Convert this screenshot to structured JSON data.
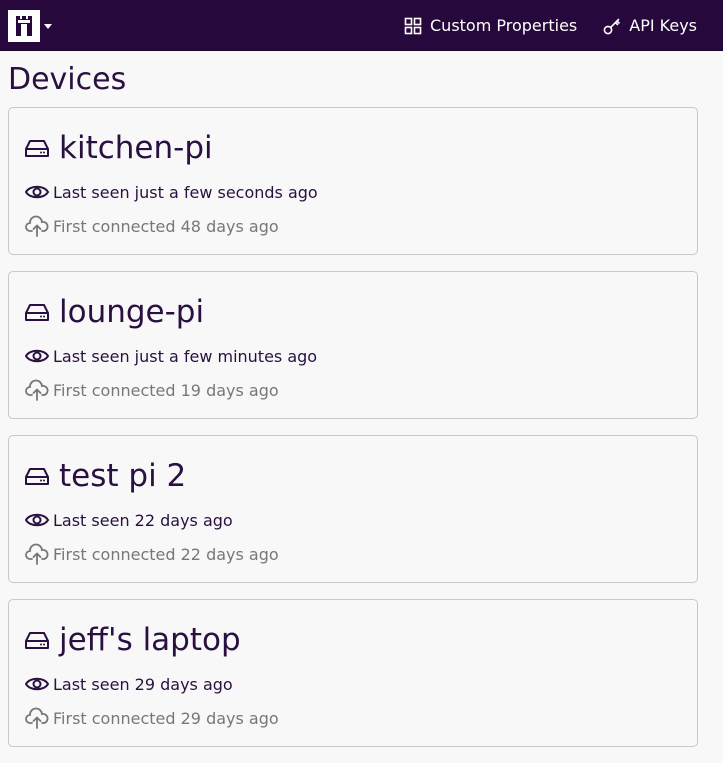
{
  "nav": {
    "custom_properties": "Custom Properties",
    "api_keys": "API Keys"
  },
  "page": {
    "title": "Devices"
  },
  "devices": [
    {
      "name": "kitchen-pi",
      "last_seen": "Last seen just a few seconds ago",
      "first_connected": "First connected 48 days ago"
    },
    {
      "name": "lounge-pi",
      "last_seen": "Last seen just a few minutes ago",
      "first_connected": "First connected 19 days ago"
    },
    {
      "name": "test pi 2",
      "last_seen": "Last seen 22 days ago",
      "first_connected": "First connected 22 days ago"
    },
    {
      "name": "jeff's laptop",
      "last_seen": "Last seen 29 days ago",
      "first_connected": "First connected 29 days ago"
    }
  ],
  "icons": {
    "brand": "castle-logo-icon",
    "custom_properties": "grid-icon",
    "api_keys": "key-icon",
    "device": "hard-drive-icon",
    "last_seen": "eye-icon",
    "first_connected": "cloud-upload-icon"
  },
  "colors": {
    "navbar": "#26083c",
    "text": "#2a1040",
    "muted": "#777777",
    "border": "#c8c8c8"
  }
}
